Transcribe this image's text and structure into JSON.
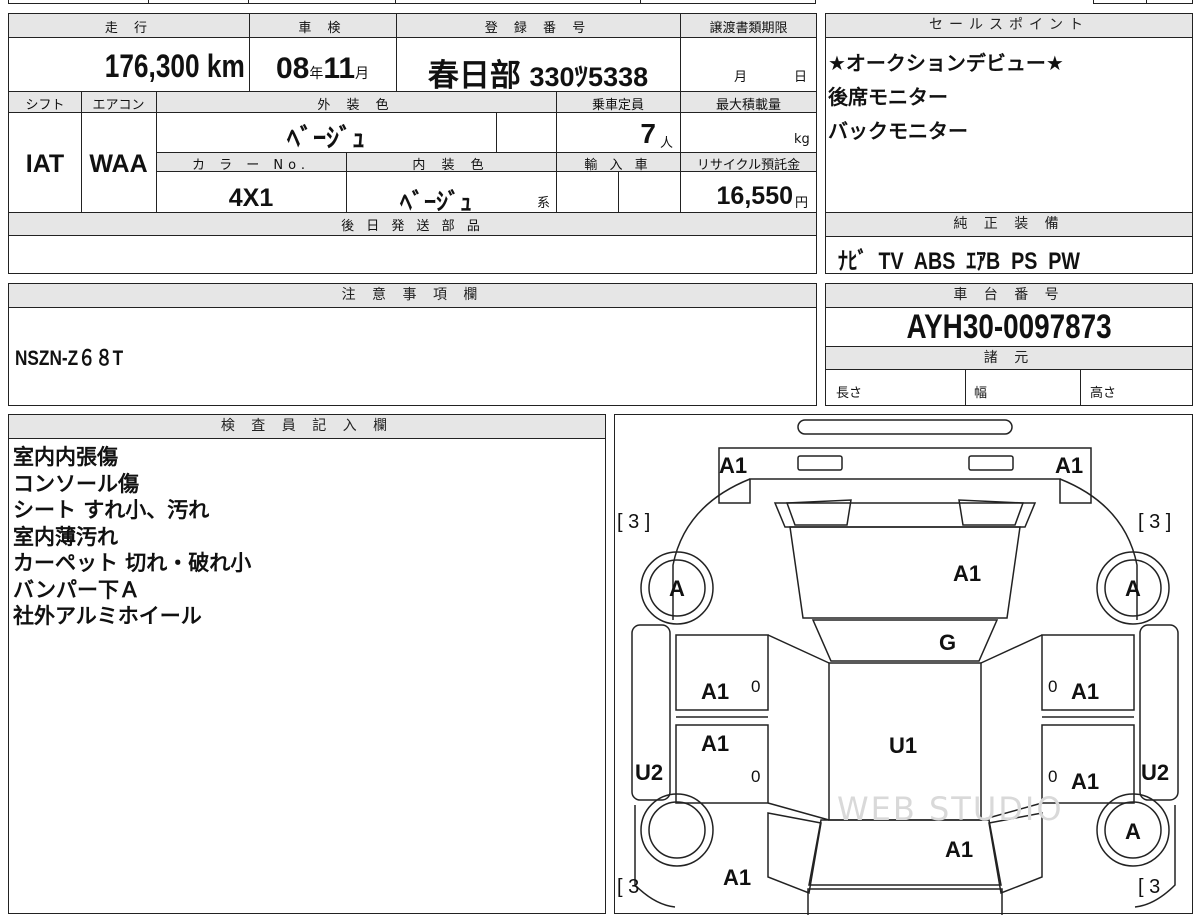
{
  "vehicle_info": {
    "mileage_label": "走 行",
    "mileage_value": "176,300 km",
    "inspection_label": "車 検",
    "inspection_year": "08",
    "year_unit": "年",
    "inspection_month": "11",
    "month_unit": "月",
    "registration_label": "登 録 番 号",
    "plate_region": "春日部",
    "plate_number": "330ﾂ5338",
    "transfer_deadline_label": "譲渡書類期限",
    "transfer_month_unit": "月",
    "transfer_day_unit": "日",
    "shift_label": "シフト",
    "aircon_label": "エアコン",
    "exterior_color_label": "外 装 色",
    "capacity_label": "乗車定員",
    "max_load_label": "最大積載量",
    "shift_value": "IAT",
    "aircon_value": "WAA",
    "exterior_color_value": "ﾍﾞｰｼﾞｭ",
    "capacity_value": "7",
    "capacity_unit": "人",
    "load_unit": "kg",
    "color_no_label": "カ ラ ー No.",
    "interior_color_label": "内 装 色",
    "import_label": "輸 入 車",
    "recycle_label": "リサイクル預託金",
    "color_no_value": "4X1",
    "interior_color_value": "ﾍﾞｰｼﾞｭ",
    "interior_suffix": "系",
    "recycle_value": "16,550",
    "recycle_unit": "円",
    "later_parts_label": "後 日 発 送 部 品"
  },
  "sales_points": {
    "label": "セールスポイント",
    "lines": [
      "★オークションデビュー★",
      "後席モニター",
      "バックモニター"
    ]
  },
  "equipment": {
    "label": "純 正 装 備",
    "value": "ﾅﾋﾞ  TV  ABS  ｴｱB  PS  PW"
  },
  "notes": {
    "label": "注 意 事 項 欄",
    "value": "NSZN-Z６８T"
  },
  "chassis": {
    "label": "車 台 番 号",
    "value": "AYH30-0097873",
    "specs_label": "諸 元",
    "length_label": "長さ",
    "width_label": "幅",
    "height_label": "高さ"
  },
  "inspector": {
    "label": "検 査 員 記 入 欄",
    "lines": [
      "室内内張傷",
      "コンソール傷",
      "シート すれ小、汚れ",
      "室内薄汚れ",
      "カーペット 切れ・破れ小",
      "バンパー下Ａ",
      "社外アルミホイール"
    ]
  },
  "diagram": {
    "marks": {
      "front_left": "A1",
      "front_right": "A1",
      "hood": "A1",
      "windshield": "G",
      "roof": "U1",
      "front_door_left": "A1",
      "rear_door_left": "A1",
      "front_door_right": "A1",
      "rear_door_right": "A1",
      "rear_left": "A1",
      "rear_center": "A1",
      "side_left": "U2",
      "side_right": "U2",
      "wheel_fl": "A",
      "wheel_fr": "A",
      "wheel_rr": "A",
      "tire_fl": "[ 3 ]",
      "tire_fr": "[ 3 ]",
      "tire_rl": "[ 3",
      "tire_rr": "[ 3",
      "door_l1": "0",
      "door_l2": "0",
      "door_r1": "0",
      "door_r2": "0"
    },
    "watermark": "WEB STUDIO"
  }
}
